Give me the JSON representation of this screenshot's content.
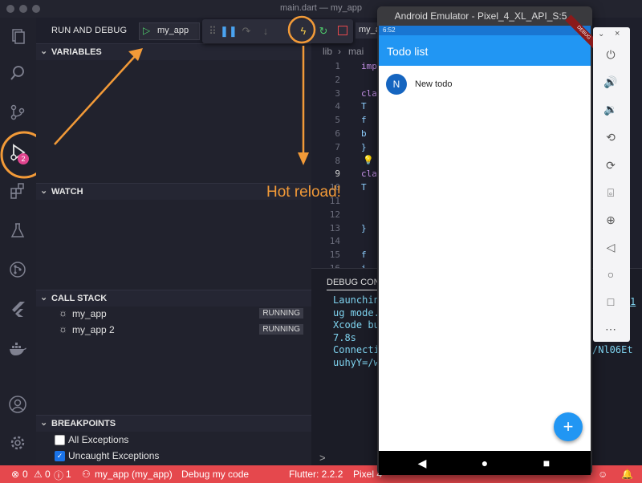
{
  "window": {
    "title": "main.dart — my_app"
  },
  "activity_bar": {
    "debug_badge": "2"
  },
  "sidebar": {
    "title": "RUN AND DEBUG",
    "config_name": "my_app",
    "sections": {
      "variables": "VARIABLES",
      "watch": "WATCH",
      "call_stack": "CALL STACK",
      "breakpoints": "BREAKPOINTS"
    },
    "call_stack": [
      {
        "name": "my_app",
        "status": "RUNNING"
      },
      {
        "name": "my_app 2",
        "status": "RUNNING"
      }
    ],
    "breakpoints": [
      {
        "label": "All Exceptions",
        "checked": false
      },
      {
        "label": "Uncaught Exceptions",
        "checked": true
      }
    ]
  },
  "debug_toolbar": {
    "target": "my_a"
  },
  "editor": {
    "breadcrumb_lib": "lib",
    "breadcrumb_file": "mai",
    "line_numbers": [
      "1",
      "2",
      "3",
      "4",
      "5",
      "6",
      "7",
      "8",
      "9",
      "10",
      "11",
      "12",
      "13",
      "14",
      "15",
      "16"
    ],
    "code_lines": [
      "imp",
      "",
      "cla",
      "  T",
      "  f",
      "  b",
      "}",
      "",
      "cla",
      "  T",
      "",
      "",
      "  }",
      "",
      "  f",
      "  i"
    ]
  },
  "panel": {
    "tab": "DEBUG CONS",
    "lines": [
      "Launching",
      "ug mode.",
      "Xcode bu",
      "7.8s",
      "Connectio",
      "uuhyY=/w"
    ],
    "right_fragment_1": "1",
    "right_fragment_2": "/Nl06Et",
    "prompt": ">"
  },
  "status_bar": {
    "errors": "0",
    "warnings": "0",
    "infos": "1",
    "session": "my_app (my_app)",
    "debug_label": "Debug my code",
    "flutter": "Flutter: 2.2.2",
    "device": "Pixel 4"
  },
  "emulator": {
    "title": "Android Emulator - Pixel_4_XL_API_S:5...",
    "time": "6:52",
    "app_title": "Todo list",
    "ribbon": "DEBUG",
    "todo_avatar": "N",
    "todo_text": "New todo",
    "fab": "+"
  },
  "annotation": {
    "hot_reload": "Hot reload!"
  },
  "colors": {
    "accent": "#f29a38",
    "status_bar": "#e5484d",
    "app_blue": "#2196f3"
  }
}
